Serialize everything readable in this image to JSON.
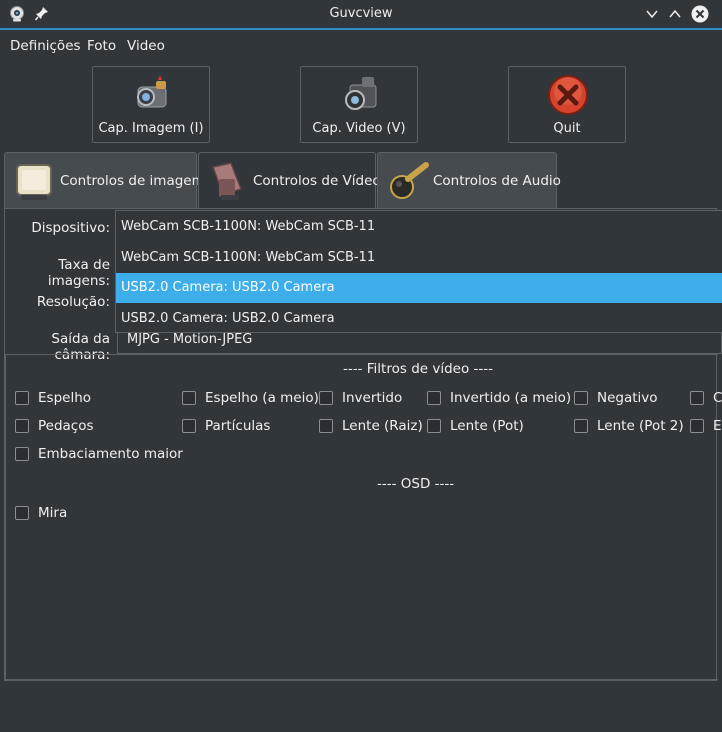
{
  "window": {
    "title": "Guvcview"
  },
  "menu": [
    "Definições",
    "Foto",
    "Video"
  ],
  "toolbar": {
    "capture_image": "Cap. Imagem (I)",
    "capture_video": "Cap. Video (V)",
    "quit": "Quit"
  },
  "tabs": [
    "Controlos de imagem",
    "Controlos de Vídeo",
    "Controlos de Audio"
  ],
  "form": {
    "device_label": "Dispositivo:",
    "framerate_label": "Taxa de imagens:",
    "resolution_label": "Resolução:",
    "output_label": "Saída da câmara:",
    "output_value": "MJPG - Motion-JPEG"
  },
  "device_dropdown": {
    "current": "WebCam SCB-1100N: WebCam SCB-11",
    "options": [
      "WebCam SCB-1100N: WebCam SCB-11",
      "USB2.0 Camera: USB2.0 Camera",
      "USB2.0 Camera: USB2.0 Camera"
    ],
    "selected_index": 1
  },
  "filters": {
    "title": "---- Filtros de vídeo ----",
    "row1": [
      "Espelho",
      "Espelho (a meio)",
      "Invertido",
      "Invertido (a meio)",
      "Negativo",
      "C"
    ],
    "row2": [
      "Pedaços",
      "Partículas",
      "Lente (Raiz)",
      "Lente (Pot)",
      "Lente (Pot 2)",
      "E"
    ],
    "row3": [
      "Embaciamento maior"
    ]
  },
  "osd": {
    "title": "---- OSD ----",
    "items": [
      "Mira"
    ]
  },
  "colors": {
    "accent": "#3daee9",
    "background": "#31363b"
  }
}
